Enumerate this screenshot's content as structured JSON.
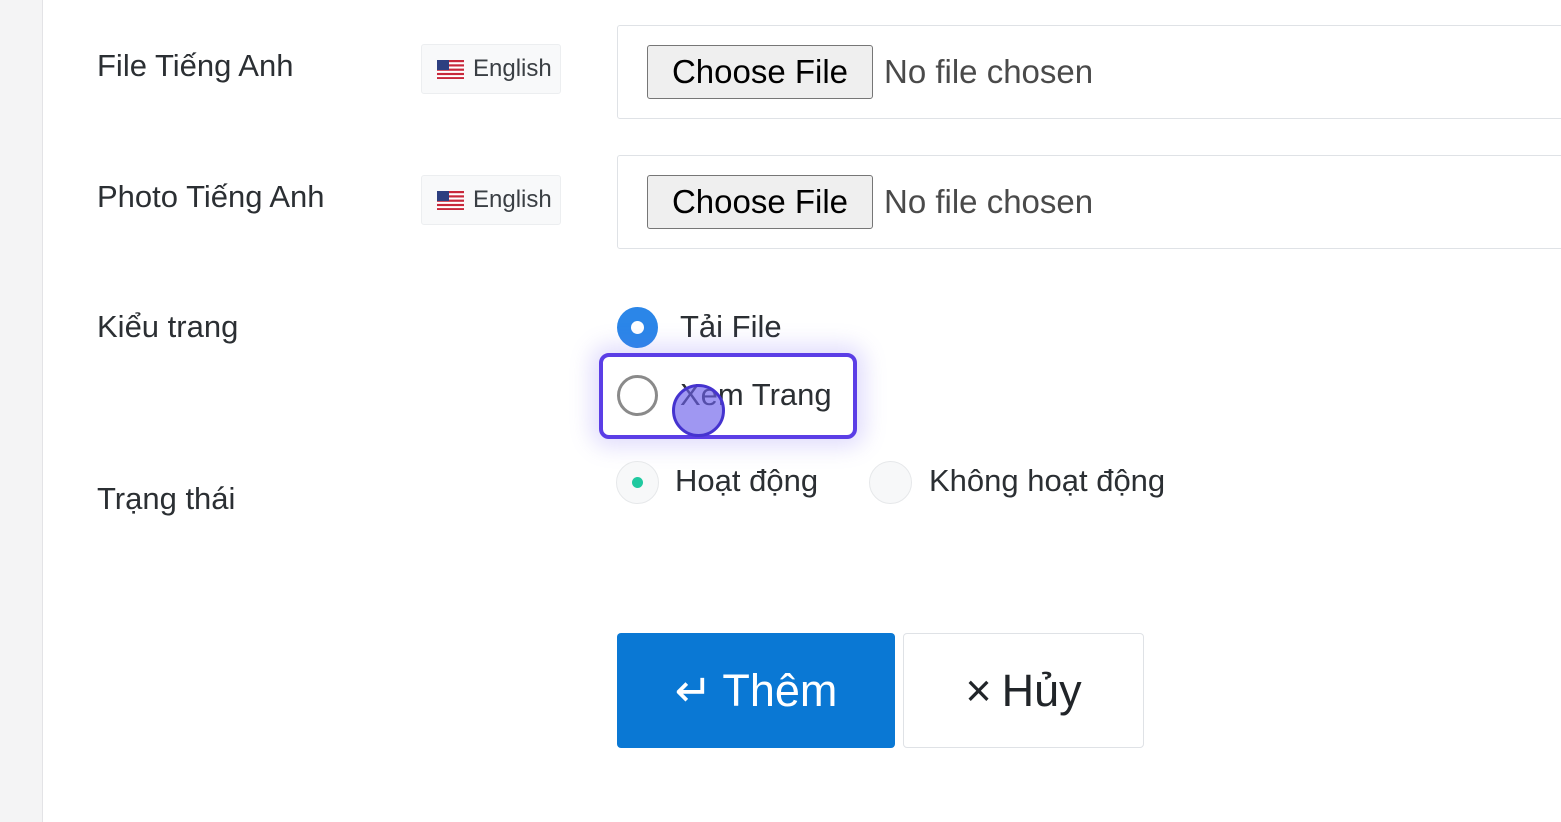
{
  "form": {
    "fields": [
      {
        "label": "File Tiếng Anh",
        "language": "English",
        "flag_icon": "us-flag-icon",
        "choose_button": "Choose File",
        "status": "No file chosen"
      },
      {
        "label": "Photo Tiếng Anh",
        "language": "English",
        "flag_icon": "us-flag-icon",
        "choose_button": "Choose File",
        "status": "No file chosen"
      }
    ],
    "page_type": {
      "label": "Kiểu trang",
      "options": [
        "Tải File",
        "Xem Trang"
      ],
      "selected": "Tải File",
      "focused": "Xem Trang"
    },
    "status": {
      "label": "Trạng thái",
      "options": [
        "Hoạt động",
        "Không hoạt động"
      ],
      "selected": "Hoạt động"
    }
  },
  "actions": {
    "submit_icon": "↵",
    "submit_label": "Thêm",
    "cancel_icon": "×",
    "cancel_label": "Hủy"
  },
  "colors": {
    "primary": "#0a78d4",
    "radio_checked": "#2b86e8",
    "status_active": "#20c9a0",
    "focus_ring": "#5b3ee6"
  }
}
